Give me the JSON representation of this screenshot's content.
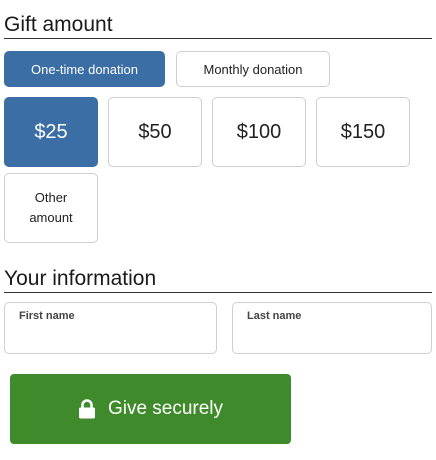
{
  "gift": {
    "title": "Gift amount",
    "frequency": [
      {
        "label": "One-time donation",
        "selected": true
      },
      {
        "label": "Monthly donation",
        "selected": false
      }
    ],
    "amounts": [
      {
        "label": "$25",
        "selected": true
      },
      {
        "label": "$50",
        "selected": false
      },
      {
        "label": "$100",
        "selected": false
      },
      {
        "label": "$150",
        "selected": false
      }
    ],
    "other": {
      "line1": "Other",
      "line2": "amount"
    }
  },
  "info": {
    "title": "Your information",
    "first_name": {
      "label": "First name",
      "value": ""
    },
    "last_name": {
      "label": "Last name",
      "value": ""
    }
  },
  "submit": {
    "label": "Give securely",
    "icon": "lock-icon"
  },
  "colors": {
    "selected": "#3a6ea5",
    "submit": "#3f8a2b"
  }
}
